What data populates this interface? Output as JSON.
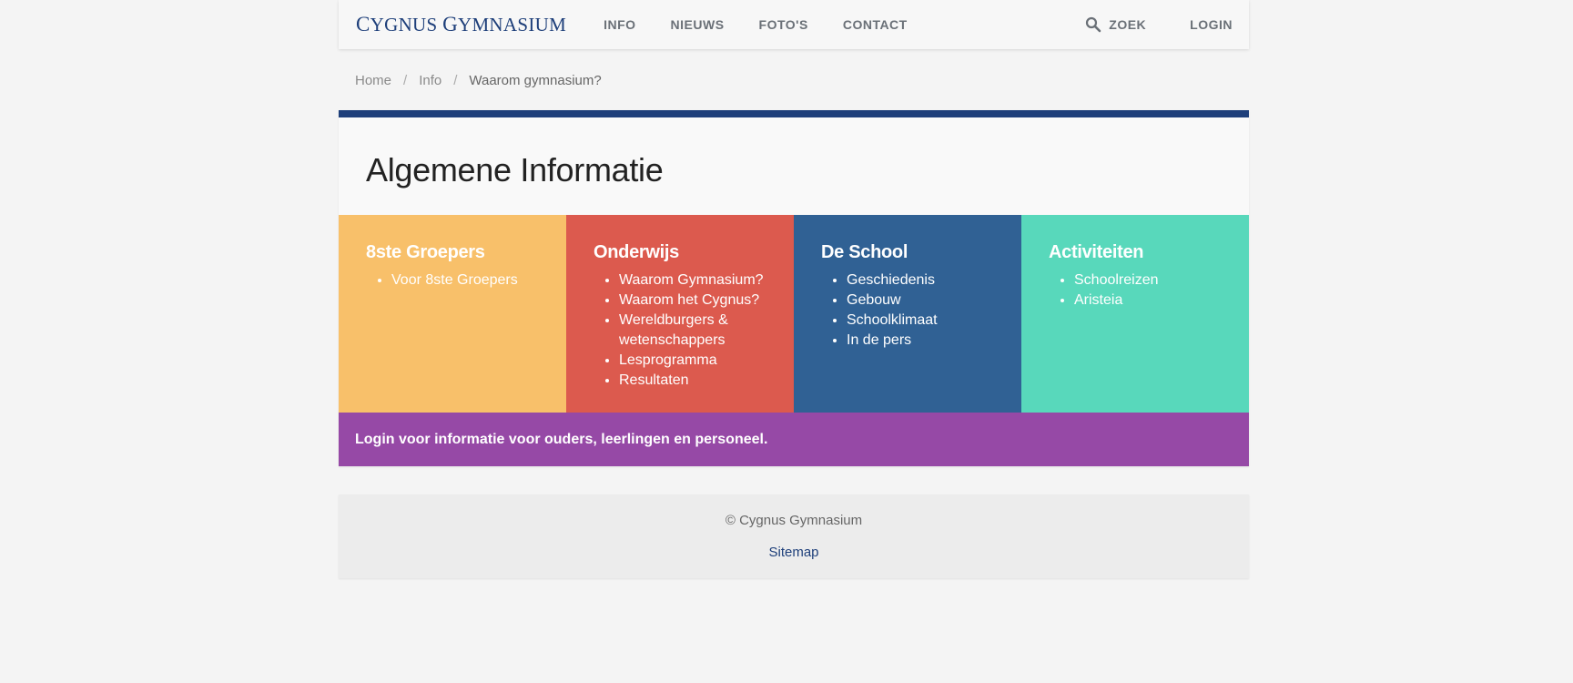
{
  "header": {
    "brand": "Cygnus Gymnasium",
    "nav": [
      "INFO",
      "NIEUWS",
      "FOTO'S",
      "CONTACT"
    ],
    "search_label": "ZOEK",
    "login_label": "LOGIN"
  },
  "breadcrumb": {
    "items": [
      "Home",
      "Info",
      "Waarom gymnasium?"
    ],
    "separator": "/"
  },
  "main": {
    "title": "Algemene Informatie",
    "accent_color": "#1e3f7a",
    "cards": [
      {
        "title": "8ste Groepers",
        "color": "#f8c06a",
        "items": [
          "Voor 8ste Groepers"
        ]
      },
      {
        "title": "Onderwijs",
        "color": "#dc5a4e",
        "items": [
          "Waarom Gymnasium?",
          "Waarom het Cygnus?",
          "Wereldburgers & wetenschappers",
          "Lesprogramma",
          "Resultaten"
        ]
      },
      {
        "title": "De School",
        "color": "#306194",
        "items": [
          "Geschiedenis",
          "Gebouw",
          "Schoolklimaat",
          "In de pers"
        ]
      },
      {
        "title": "Activiteiten",
        "color": "#58d8bb",
        "items": [
          "Schoolreizen",
          "Aristeia"
        ]
      }
    ],
    "login_band": {
      "text": "Login voor informatie voor ouders, leerlingen en personeel.",
      "color": "#9649a6"
    }
  },
  "footer": {
    "copyright": "© Cygnus Gymnasium",
    "sitemap": "Sitemap"
  }
}
